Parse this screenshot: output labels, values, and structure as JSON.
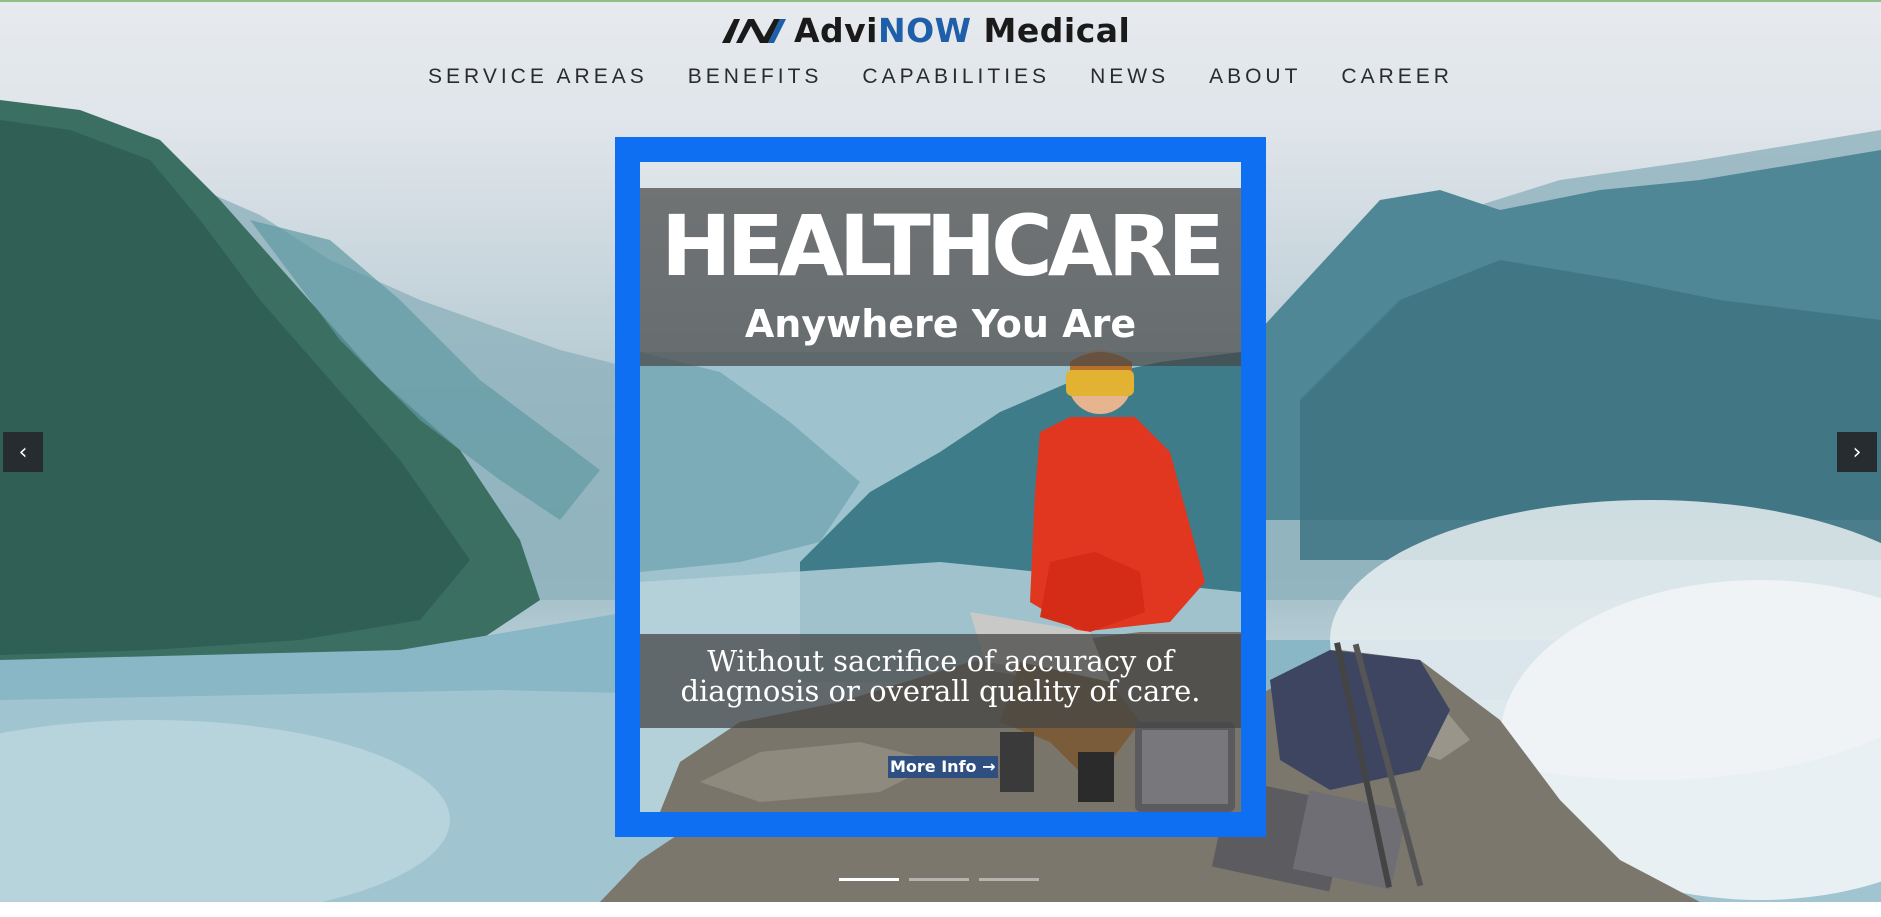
{
  "brand": {
    "prefix": "Advi",
    "highlight": "NOW",
    "suffix": " Medical",
    "colors": {
      "dark": "#1a1a1a",
      "blue": "#1f5ea8"
    }
  },
  "nav": {
    "items": [
      {
        "label": "SERVICE AREAS"
      },
      {
        "label": "BENEFITS"
      },
      {
        "label": "CAPABILITIES"
      },
      {
        "label": "NEWS"
      },
      {
        "label": "ABOUT"
      },
      {
        "label": "CAREER"
      }
    ]
  },
  "slide": {
    "title": "HEALTHCARE",
    "subtitle": "Anywhere You Are",
    "description": "Without sacrifice of accuracy of diagnosis or overall quality of care.",
    "cta_label": "More Info →",
    "frame_color": "#0f6ff2"
  },
  "carousel": {
    "prev_icon": "chevron-left-icon",
    "next_icon": "chevron-right-icon",
    "prev_glyph": "‹",
    "next_glyph": "›",
    "slide_count": 3,
    "active_index": 0
  }
}
